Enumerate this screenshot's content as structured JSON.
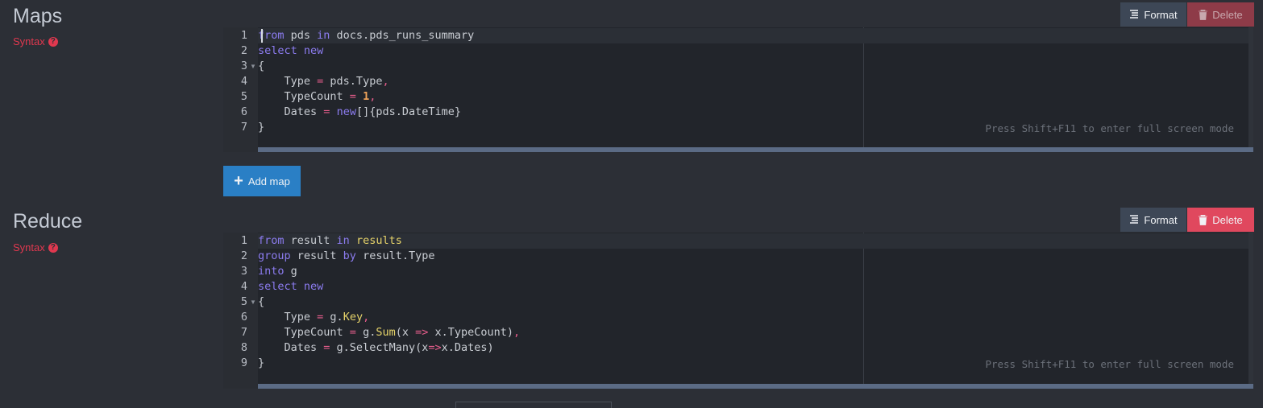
{
  "maps": {
    "title": "Maps",
    "syntax_label": "Syntax",
    "format_label": "Format",
    "delete_label": "Delete",
    "hint": "Press Shift+F11 to enter full screen mode",
    "line_numbers": [
      "1",
      "2",
      "3",
      "4",
      "5",
      "6",
      "7"
    ],
    "add_label": "Add map"
  },
  "reduce": {
    "title": "Reduce",
    "syntax_label": "Syntax",
    "format_label": "Format",
    "delete_label": "Delete",
    "hint": "Press Shift+F11 to enter full screen mode",
    "line_numbers": [
      "1",
      "2",
      "3",
      "4",
      "5",
      "6",
      "7",
      "8",
      "9"
    ]
  },
  "code": {
    "map_lines": [
      "from pds in docs.pds_runs_summary",
      "select new",
      "{",
      "    Type = pds.Type,",
      "    TypeCount = 1,",
      "    Dates = new[]{pds.DateTime}",
      "}"
    ],
    "reduce_lines": [
      "from result in results",
      "group result by result.Type",
      "into g",
      "select new",
      "{",
      "    Type = g.Key,",
      "    TypeCount = g.Sum(x => x.TypeCount),",
      "    Dates = g.SelectMany(x=>x.Dates)",
      "}"
    ]
  },
  "colors": {
    "accent": "#2a7fc5",
    "danger": "#e0485e",
    "keyword": "#8c7cf0",
    "number": "#f0a35a",
    "operator": "#e75d8c"
  },
  "icons": {
    "format": "format-lines-icon",
    "delete": "trash-icon",
    "add": "plus-icon",
    "help": "question-circle-icon"
  }
}
